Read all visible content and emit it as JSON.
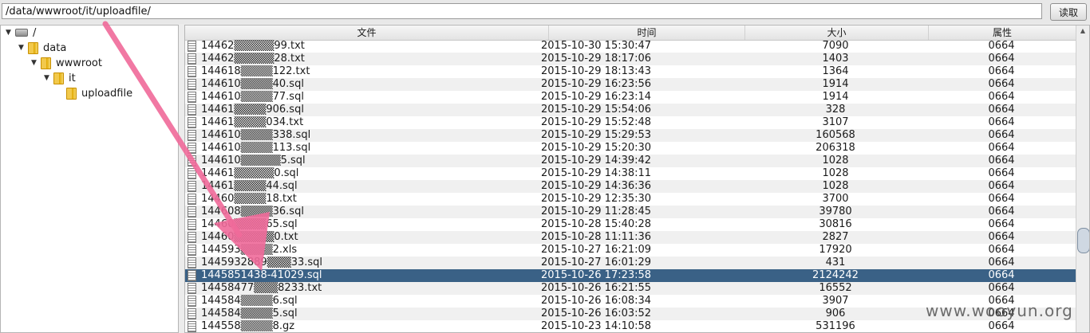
{
  "topbar": {
    "path_value": "/data/wwwroot/it/uploadfile/",
    "read_button": "读取"
  },
  "tree": [
    {
      "label": "/",
      "icon": "drive-icon",
      "expanded": true
    },
    {
      "label": "data",
      "icon": "folder-icon",
      "expanded": true
    },
    {
      "label": "wwwroot",
      "icon": "folder-icon",
      "expanded": true
    },
    {
      "label": "it",
      "icon": "folder-icon",
      "expanded": true
    },
    {
      "label": "uploadfile",
      "icon": "folder-icon",
      "expanded": false
    }
  ],
  "table": {
    "headers": {
      "file": "文件",
      "time": "时间",
      "size": "大小",
      "attr": "属性"
    },
    "rows": [
      {
        "file": "14462▒▒▒▒▒99.txt",
        "time": "2015-10-30 15:30:47",
        "size": "7090",
        "attr": "0664"
      },
      {
        "file": "14462▒▒▒▒▒28.txt",
        "time": "2015-10-29 18:17:06",
        "size": "1403",
        "attr": "0664"
      },
      {
        "file": "144618▒▒▒▒122.txt",
        "time": "2015-10-29 18:13:43",
        "size": "1364",
        "attr": "0664"
      },
      {
        "file": "144610▒▒▒▒40.sql",
        "time": "2015-10-29 16:23:56",
        "size": "1914",
        "attr": "0664"
      },
      {
        "file": "144610▒▒▒▒77.sql",
        "time": "2015-10-29 16:23:14",
        "size": "1914",
        "attr": "0664"
      },
      {
        "file": "14461▒▒▒▒906.sql",
        "time": "2015-10-29 15:54:06",
        "size": "328",
        "attr": "0664"
      },
      {
        "file": "14461▒▒▒▒034.txt",
        "time": "2015-10-29 15:52:48",
        "size": "3107",
        "attr": "0664"
      },
      {
        "file": "144610▒▒▒▒338.sql",
        "time": "2015-10-29 15:29:53",
        "size": "160568",
        "attr": "0664"
      },
      {
        "file": "144610▒▒▒▒113.sql",
        "time": "2015-10-29 15:20:30",
        "size": "206318",
        "attr": "0664"
      },
      {
        "file": "144610▒▒▒▒▒5.sql",
        "time": "2015-10-29 14:39:42",
        "size": "1028",
        "attr": "0664"
      },
      {
        "file": "14461▒▒▒▒▒0.sql",
        "time": "2015-10-29 14:38:11",
        "size": "1028",
        "attr": "0664"
      },
      {
        "file": "14461▒▒▒▒44.sql",
        "time": "2015-10-29 14:36:36",
        "size": "1028",
        "attr": "0664"
      },
      {
        "file": "14460▒▒▒▒18.txt",
        "time": "2015-10-29 12:35:30",
        "size": "3700",
        "attr": "0664"
      },
      {
        "file": "144608▒▒▒▒36.sql",
        "time": "2015-10-29 11:28:45",
        "size": "39780",
        "attr": "0664"
      },
      {
        "file": "14460▒▒▒▒65.sql",
        "time": "2015-10-28 15:40:28",
        "size": "30816",
        "attr": "0664"
      },
      {
        "file": "14460▒▒▒▒▒0.txt",
        "time": "2015-10-28 11:11:36",
        "size": "2827",
        "attr": "0664"
      },
      {
        "file": "144593▒▒▒▒2.xls",
        "time": "2015-10-27 16:21:09",
        "size": "17920",
        "attr": "0664"
      },
      {
        "file": "1445932889▒▒▒33.sql",
        "time": "2015-10-27 16:01:29",
        "size": "431",
        "attr": "0664"
      },
      {
        "file": "1445851438-41029.sql",
        "time": "2015-10-26 17:23:58",
        "size": "2124242",
        "attr": "0664",
        "selected": true
      },
      {
        "file": "14458477▒▒▒8233.txt",
        "time": "2015-10-26 16:21:55",
        "size": "16552",
        "attr": "0664"
      },
      {
        "file": "144584▒▒▒▒6.sql",
        "time": "2015-10-26 16:08:34",
        "size": "3907",
        "attr": "0664"
      },
      {
        "file": "144584▒▒▒▒5.sql",
        "time": "2015-10-26 16:03:52",
        "size": "906",
        "attr": "0664"
      },
      {
        "file": "144558▒▒▒▒8.gz",
        "time": "2015-10-23 14:10:58",
        "size": "531196",
        "attr": "0664"
      }
    ]
  },
  "watermark": "www.wooyun.org",
  "colors": {
    "selection": "#3a6186",
    "annotation_arrow": "#f06a9a"
  }
}
